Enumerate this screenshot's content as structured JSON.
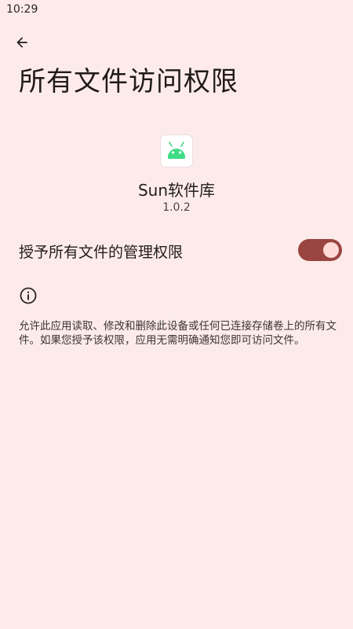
{
  "status_bar": {
    "time": "10:29"
  },
  "header": {
    "back_icon": "arrow-left-icon",
    "title": "所有文件访问权限"
  },
  "app": {
    "icon": "android-app-icon",
    "name": "Sun软件库",
    "version": "1.0.2"
  },
  "permission": {
    "toggle_label": "授予所有文件的管理权限",
    "toggle_on": true,
    "accent_color": "#9a4540"
  },
  "info": {
    "icon": "info-icon",
    "description": "允许此应用读取、修改和删除此设备或任何已连接存储卷上的所有文件。如果您授予该权限，应用无需明确通知您即可访问文件。"
  },
  "theme": {
    "background": "#fcebea"
  }
}
